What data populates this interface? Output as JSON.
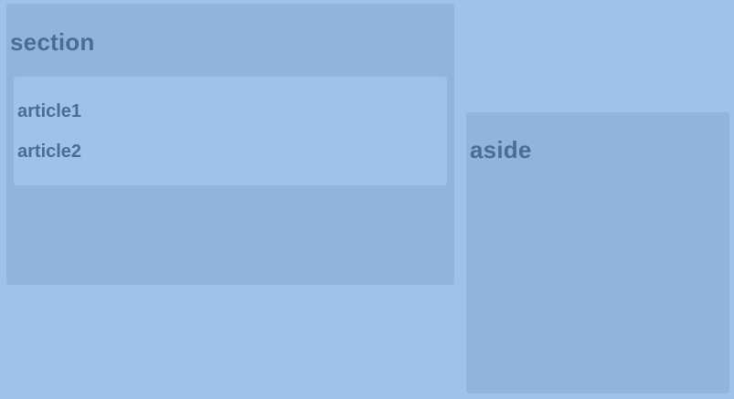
{
  "section": {
    "title": "section",
    "articles": [
      {
        "label": "article1"
      },
      {
        "label": "article2"
      }
    ]
  },
  "aside": {
    "title": "aside"
  },
  "colors": {
    "background": "#9ec3e8",
    "panel": "#90b5da",
    "text": "#4a6d93"
  }
}
